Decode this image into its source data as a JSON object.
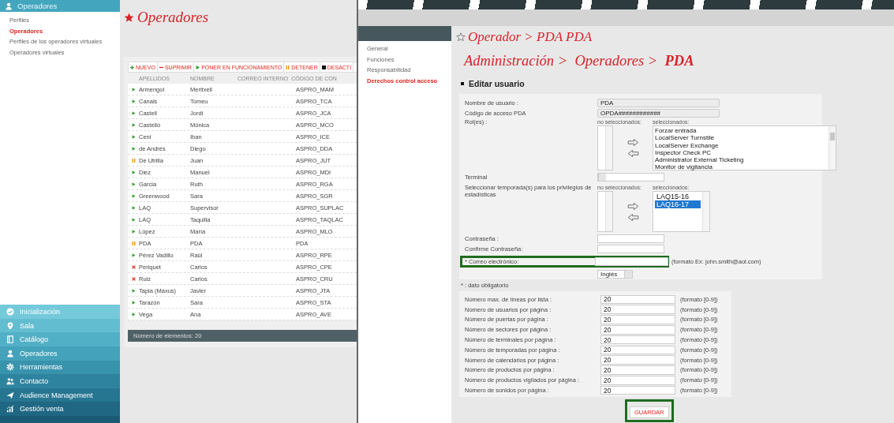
{
  "sidebar": {
    "header": "Operadores",
    "items": [
      {
        "label": "Perfiles",
        "selected": false
      },
      {
        "label": "Operadores",
        "selected": true
      },
      {
        "label": "Perfiles de los operadores virtuales",
        "selected": false
      },
      {
        "label": "Operadores virtuales",
        "selected": false
      }
    ],
    "menu": [
      "Inicialización",
      "Sala",
      "Catálogo",
      "Operadores",
      "Herramientas",
      "Contacto",
      "Audience Management",
      "Gestión venta"
    ]
  },
  "page": {
    "title": "Operadores",
    "toolbar": [
      {
        "kind": "add",
        "label": "NUEVO"
      },
      {
        "kind": "delete",
        "label": "SUPRIMIR"
      },
      {
        "kind": "start",
        "label": "PONER EN FUNCIONAMIENTO"
      },
      {
        "kind": "pause",
        "label": "DETENER"
      },
      {
        "kind": "stop",
        "label": "DESACTI"
      }
    ],
    "columns": [
      "APELLIDOS",
      "NOMBRE",
      "CORREO INTERNO",
      "CÓDIGO DE CON"
    ],
    "rows": [
      {
        "kind": "active",
        "apellidos": "Armengol",
        "nombre": "Meritxell",
        "codigo": "ASPRO_MAM"
      },
      {
        "kind": "active",
        "apellidos": "Canals",
        "nombre": "Tomeu",
        "codigo": "ASPRO_TCA"
      },
      {
        "kind": "active",
        "apellidos": "Castell",
        "nombre": "Jordi",
        "codigo": "ASPRO_JCA"
      },
      {
        "kind": "active",
        "apellidos": "Castelló",
        "nombre": "Mónica",
        "codigo": "ASPRO_MCO"
      },
      {
        "kind": "active",
        "apellidos": "Ceni",
        "nombre": "Iban",
        "codigo": "ASPRO_ICE"
      },
      {
        "kind": "active",
        "apellidos": "de Andrés",
        "nombre": "Diego",
        "codigo": "ASPRO_DDA"
      },
      {
        "kind": "paused",
        "apellidos": "De Utrilla",
        "nombre": "Juan",
        "codigo": "ASPRO_JUT"
      },
      {
        "kind": "active",
        "apellidos": "Diez",
        "nombre": "Manuel",
        "codigo": "ASPRO_MDI"
      },
      {
        "kind": "active",
        "apellidos": "Garcia",
        "nombre": "Ruth",
        "codigo": "ASPRO_RGA"
      },
      {
        "kind": "active",
        "apellidos": "Greenwood",
        "nombre": "Sara",
        "codigo": "ASPRO_SGR"
      },
      {
        "kind": "active",
        "apellidos": "LAQ",
        "nombre": "Supervisor",
        "codigo": "ASPRO_SUPLAC"
      },
      {
        "kind": "active",
        "apellidos": "LAQ",
        "nombre": "Taquilla",
        "codigo": "ASPRO_TAQLAC"
      },
      {
        "kind": "active",
        "apellidos": "López",
        "nombre": "María",
        "codigo": "ASPRO_MLO"
      },
      {
        "kind": "paused",
        "apellidos": "PDA",
        "nombre": "PDA",
        "codigo": "PDA"
      },
      {
        "kind": "active",
        "apellidos": "Pérez Vadillo",
        "nombre": "Raúl",
        "codigo": "ASPRO_RPE"
      },
      {
        "kind": "disabled",
        "apellidos": "Periquet",
        "nombre": "Carlos",
        "codigo": "ASPRO_CPE"
      },
      {
        "kind": "disabled",
        "apellidos": "Ruiz",
        "nombre": "Carlos",
        "codigo": "ASPRO_CRU"
      },
      {
        "kind": "active",
        "apellidos": "Tapia (Maxus)",
        "nombre": "Javier",
        "codigo": "ASPRO_JTA"
      },
      {
        "kind": "active",
        "apellidos": "Tarazón",
        "nombre": "Sara",
        "codigo": "ASPRO_STA"
      },
      {
        "kind": "active",
        "apellidos": "Vega",
        "nombre": "Ana",
        "codigo": "ASPRO_AVE"
      }
    ],
    "footer": "Número de elementos: 20"
  },
  "editor": {
    "nav": [
      {
        "label": "General",
        "selected": false
      },
      {
        "label": "Funciones",
        "selected": false
      },
      {
        "label": "Responsabilidad",
        "selected": false
      },
      {
        "label": "Derechos control acceso",
        "selected": true
      }
    ],
    "title": "Operador > PDA PDA",
    "breadcrumb": "Administración >  Operadores >  **PDA**",
    "section": "Editar usuario",
    "username": {
      "label": "Nombre de usuario :",
      "value": "PDA"
    },
    "access_code": {
      "label": "Código de acceso PDA",
      "value": "OPDA############"
    },
    "roles": {
      "label": "Rol(es) :",
      "unselected_caption": "no seleccionados:",
      "selected_caption": "seleccionados:",
      "selected_items": [
        "Forzar entrada",
        "LocalServer Turnstile",
        "LocalServer Exchange",
        "Inspector Check PC",
        "Administrator External Ticketing",
        "Monitor de vigilancia"
      ]
    },
    "terminal": {
      "label": "Terminal"
    },
    "seasons": {
      "label": "Seleccionar temporada(s) para los privilegios de estadísticas",
      "unselected_caption": "no seleccionados:",
      "selected_caption": "seleccionados:",
      "selected_items": [
        {
          "label": "LAQ15-16",
          "selected": false
        },
        {
          "label": "LAQ16-17",
          "selected": true
        }
      ]
    },
    "password": {
      "label": "Contraseña :"
    },
    "confirm_password": {
      "label": "Confirme Contraseña:"
    },
    "email": {
      "label": "* Correo electrónico:",
      "hint": "(formato  Ex: john.smith@aol.com)",
      "highlighted": true
    },
    "language": {
      "value": "Inglés"
    },
    "required_note": "* : dato obligatorio",
    "preferences": [
      {
        "label": "Número max. de líneas por lista :",
        "value": "20",
        "hint": "(formato [0-9])"
      },
      {
        "label": "Número de usuarios por página :",
        "value": "20",
        "hint": "(formato [0-9])"
      },
      {
        "label": "Número de puertas por página :",
        "value": "20",
        "hint": "(formato [0-9])"
      },
      {
        "label": "Número de sectores por página :",
        "value": "20",
        "hint": "(formato [0-9])"
      },
      {
        "label": "Número de terminales por página :",
        "value": "20",
        "hint": "(formato [0-9])"
      },
      {
        "label": "Número de temporadas por página :",
        "value": "20",
        "hint": "(formato [0-9])"
      },
      {
        "label": "Número de calendarios por página :",
        "value": "20",
        "hint": "(formato [0-9])"
      },
      {
        "label": "Número de productos por página :",
        "value": "20",
        "hint": "(formato [0-9])"
      },
      {
        "label": "Número de productos vigilados por página :",
        "value": "20",
        "hint": "(formato [0-9])"
      },
      {
        "label": "Número de sonidos por página :",
        "value": "20",
        "hint": "(formato [0-9])"
      }
    ],
    "save": {
      "label": "GUARDAR",
      "highlighted": true
    }
  }
}
